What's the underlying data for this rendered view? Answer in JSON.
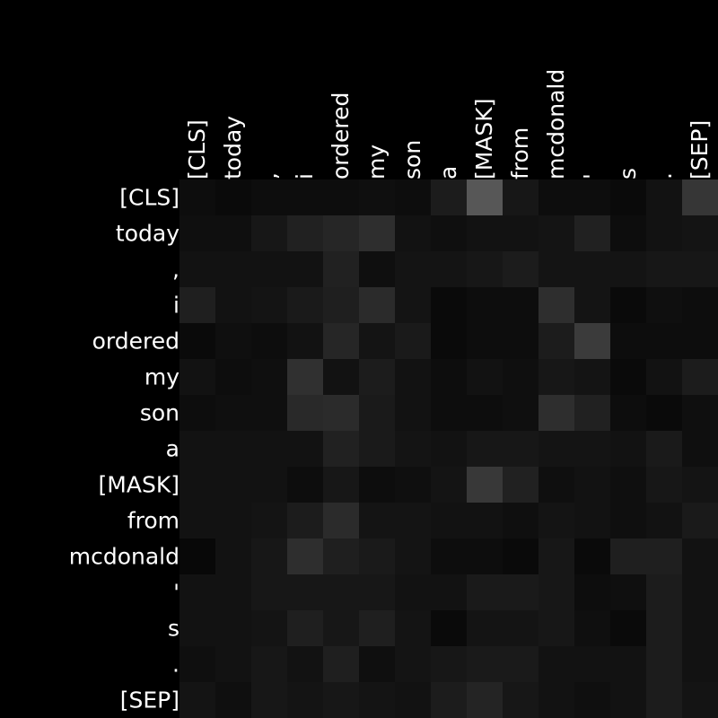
{
  "chart_data": {
    "type": "heatmap",
    "title": "",
    "xlabel": "",
    "ylabel": "",
    "x_tokens": [
      "[CLS]",
      "today",
      ",",
      "i",
      "ordered",
      "my",
      "son",
      "a",
      "[MASK]",
      "from",
      "mcdonald",
      "'",
      "s",
      ".",
      "[SEP]"
    ],
    "y_tokens": [
      "[CLS]",
      "today",
      ",",
      "i",
      "ordered",
      "my",
      "son",
      "a",
      "[MASK]",
      "from",
      "mcdonald",
      "'",
      "s",
      ".",
      "[SEP]"
    ],
    "value_range": [
      0,
      1
    ],
    "colormap": "gray",
    "colors": {
      "background": "#000000",
      "text": "#ffffff"
    },
    "values": [
      [
        0.05,
        0.04,
        0.05,
        0.05,
        0.05,
        0.06,
        0.05,
        0.11,
        0.34,
        0.09,
        0.05,
        0.05,
        0.04,
        0.07,
        0.21
      ],
      [
        0.06,
        0.06,
        0.09,
        0.13,
        0.15,
        0.18,
        0.07,
        0.06,
        0.07,
        0.07,
        0.08,
        0.13,
        0.05,
        0.07,
        0.08
      ],
      [
        0.07,
        0.07,
        0.07,
        0.07,
        0.13,
        0.06,
        0.08,
        0.08,
        0.09,
        0.11,
        0.08,
        0.08,
        0.08,
        0.09,
        0.09
      ],
      [
        0.12,
        0.07,
        0.08,
        0.1,
        0.12,
        0.17,
        0.08,
        0.04,
        0.05,
        0.05,
        0.18,
        0.08,
        0.04,
        0.06,
        0.05
      ],
      [
        0.04,
        0.06,
        0.05,
        0.07,
        0.15,
        0.08,
        0.1,
        0.04,
        0.05,
        0.05,
        0.11,
        0.23,
        0.05,
        0.05,
        0.05
      ],
      [
        0.07,
        0.05,
        0.06,
        0.19,
        0.07,
        0.11,
        0.07,
        0.05,
        0.07,
        0.06,
        0.09,
        0.08,
        0.04,
        0.07,
        0.11
      ],
      [
        0.05,
        0.06,
        0.06,
        0.16,
        0.17,
        0.1,
        0.07,
        0.05,
        0.05,
        0.06,
        0.18,
        0.13,
        0.05,
        0.04,
        0.06
      ],
      [
        0.07,
        0.07,
        0.07,
        0.07,
        0.13,
        0.1,
        0.08,
        0.07,
        0.09,
        0.09,
        0.08,
        0.08,
        0.07,
        0.1,
        0.06
      ],
      [
        0.07,
        0.07,
        0.07,
        0.05,
        0.09,
        0.05,
        0.06,
        0.08,
        0.22,
        0.13,
        0.06,
        0.07,
        0.06,
        0.09,
        0.08
      ],
      [
        0.07,
        0.07,
        0.08,
        0.11,
        0.17,
        0.08,
        0.08,
        0.07,
        0.07,
        0.06,
        0.08,
        0.07,
        0.06,
        0.07,
        0.1
      ],
      [
        0.03,
        0.07,
        0.09,
        0.18,
        0.12,
        0.1,
        0.08,
        0.05,
        0.05,
        0.04,
        0.09,
        0.04,
        0.12,
        0.12,
        0.07
      ],
      [
        0.07,
        0.07,
        0.09,
        0.09,
        0.09,
        0.09,
        0.07,
        0.07,
        0.1,
        0.1,
        0.09,
        0.05,
        0.06,
        0.11,
        0.07
      ],
      [
        0.07,
        0.07,
        0.08,
        0.12,
        0.09,
        0.12,
        0.08,
        0.04,
        0.08,
        0.08,
        0.09,
        0.06,
        0.04,
        0.11,
        0.07
      ],
      [
        0.06,
        0.07,
        0.09,
        0.07,
        0.12,
        0.06,
        0.08,
        0.09,
        0.1,
        0.1,
        0.07,
        0.07,
        0.07,
        0.11,
        0.07
      ],
      [
        0.08,
        0.06,
        0.09,
        0.08,
        0.09,
        0.08,
        0.07,
        0.11,
        0.14,
        0.09,
        0.07,
        0.06,
        0.07,
        0.11,
        0.08
      ]
    ]
  }
}
